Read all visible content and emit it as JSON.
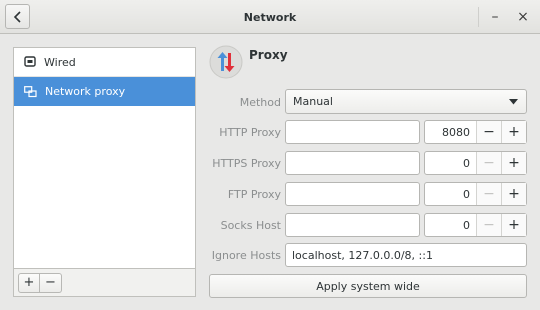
{
  "window": {
    "title": "Network"
  },
  "header": {
    "back_icon": "chevron-left-icon",
    "minimize_label": "–",
    "close_label": "×"
  },
  "sidebar": {
    "items": [
      {
        "label": "Wired",
        "icon": "wired-network-icon",
        "selected": false
      },
      {
        "label": "Network proxy",
        "icon": "network-proxy-icon",
        "selected": true
      }
    ],
    "add_label": "+",
    "remove_label": "−"
  },
  "proxy": {
    "title": "Proxy",
    "method_label": "Method",
    "method_value": "Manual",
    "rows": [
      {
        "label": "HTTP Proxy",
        "host": "",
        "port": "8080",
        "minus_enabled": true
      },
      {
        "label": "HTTPS Proxy",
        "host": "",
        "port": "0",
        "minus_enabled": false
      },
      {
        "label": "FTP Proxy",
        "host": "",
        "port": "0",
        "minus_enabled": false
      },
      {
        "label": "Socks Host",
        "host": "",
        "port": "0",
        "minus_enabled": false
      }
    ],
    "ignore_hosts_label": "Ignore Hosts",
    "ignore_hosts_value": "localhost, 127.0.0.0/8, ::1",
    "apply_label": "Apply system wide",
    "minus_symbol": "−",
    "plus_symbol": "+"
  },
  "colors": {
    "selection": "#4a90d9",
    "arrow_blue": "#4a90d9",
    "arrow_red": "#e0303a"
  }
}
